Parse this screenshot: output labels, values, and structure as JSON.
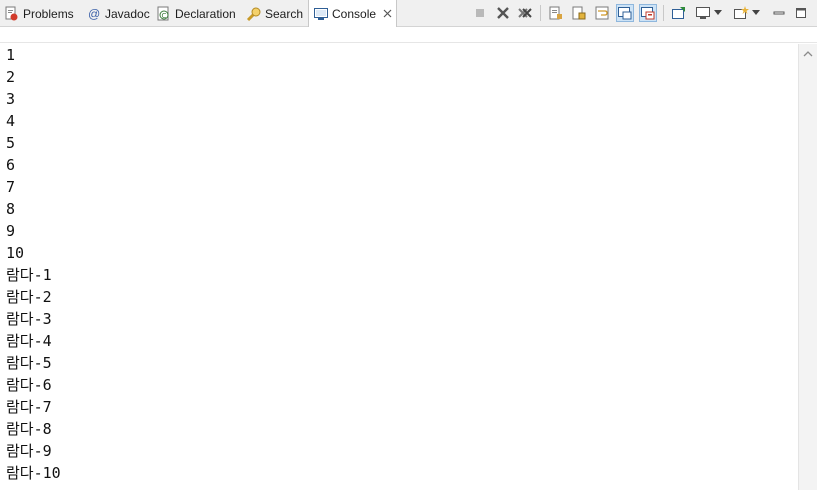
{
  "tabs": [
    {
      "label": "Problems",
      "icon": "problems-icon"
    },
    {
      "label": "Javadoc",
      "icon": "javadoc-icon"
    },
    {
      "label": "Declaration",
      "icon": "declaration-icon"
    },
    {
      "label": "Search",
      "icon": "search-icon"
    },
    {
      "label": "Console",
      "icon": "console-icon",
      "active": true
    }
  ],
  "toolbar": [
    "terminate-icon",
    "remove-launch-icon",
    "remove-all-terminated-icon",
    "clear-console-icon",
    "scroll-lock-icon",
    "word-wrap-icon",
    "show-console-on-stdout-icon",
    "show-console-on-stderr-icon",
    "pin-console-icon",
    "display-selected-console-icon",
    "open-console-icon",
    "minimize-icon",
    "maximize-icon"
  ],
  "console": {
    "lines": [
      "1",
      "2",
      "3",
      "4",
      "5",
      "6",
      "7",
      "8",
      "9",
      "10",
      "람다-1",
      "람다-2",
      "람다-3",
      "람다-4",
      "람다-5",
      "람다-6",
      "람다-7",
      "람다-8",
      "람다-9",
      "람다-10"
    ]
  }
}
